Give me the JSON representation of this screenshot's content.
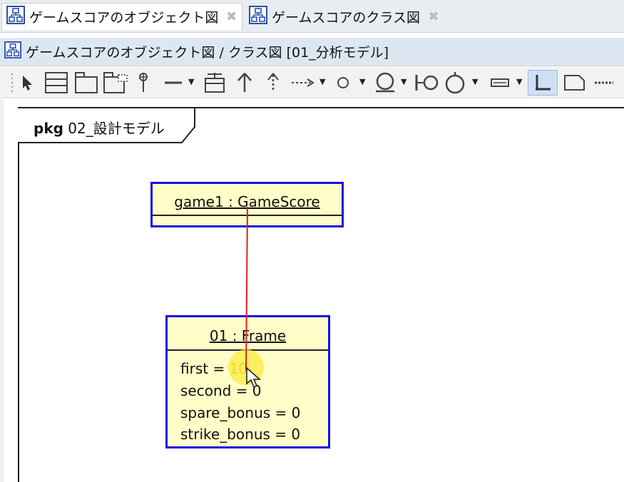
{
  "tabs": [
    {
      "label": "ゲームスコアのオブジェクト図",
      "icon": "diagram-icon",
      "active": true
    },
    {
      "label": "ゲームスコアのクラス図",
      "icon": "diagram-icon",
      "active": false
    }
  ],
  "diagram": {
    "title": "ゲームスコアのオブジェクト図 / クラス図 [01_分析モデル]"
  },
  "toolbar": {
    "tools": [
      "select",
      "class",
      "package",
      "package-template",
      "pin",
      "association",
      "association-class",
      "generalization",
      "realization",
      "dependency",
      "node",
      "component",
      "interface",
      "usage",
      "note-rect",
      "link",
      "note",
      "dashed-line"
    ]
  },
  "package": {
    "keyword": "pkg",
    "name": "02_設計モデル"
  },
  "objects": {
    "game": {
      "title": "game1 : GameScore"
    },
    "frame": {
      "title": "01 : Frame",
      "attrs": [
        {
          "name": "first = ",
          "value": "10"
        },
        {
          "text": "second = 0"
        },
        {
          "text": "spare_bonus = 0"
        },
        {
          "text": "strike_bonus = 0"
        }
      ]
    }
  },
  "colors": {
    "object_fill": "#fffdc8",
    "object_border": "#1010e0",
    "link": "#e02020",
    "highlight": "#faeb3c"
  }
}
